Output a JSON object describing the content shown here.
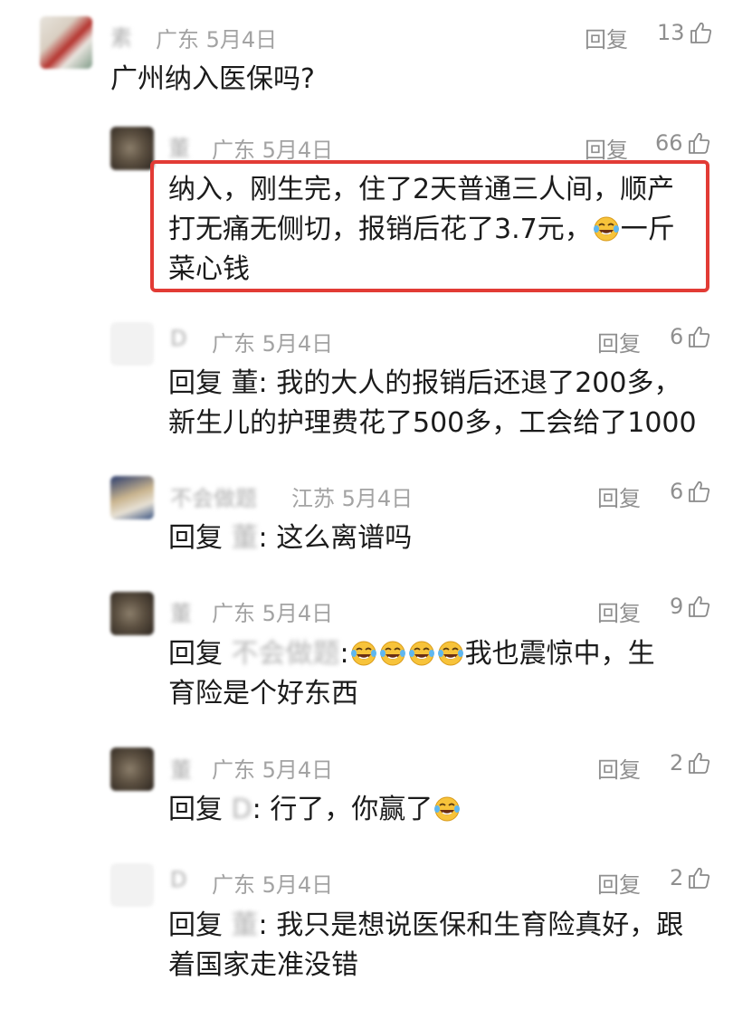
{
  "comments": [
    {
      "id": "c1",
      "user": "素",
      "location": "广东",
      "date": "5月4日",
      "reply_label": "回复",
      "likes": "13",
      "lines": [
        "广州纳入医保吗?"
      ]
    },
    {
      "id": "c2",
      "user": "董",
      "location": "广东",
      "date": "5月4日",
      "reply_label": "回复",
      "likes": "66",
      "lines": [
        "纳入，刚生完，住了2天普通三人间，顺产",
        "打无痛无侧切，报销后花了3.7元，",
        "一斤",
        "菜心钱"
      ]
    },
    {
      "id": "c3",
      "user": "D",
      "location": "广东",
      "date": "5月4日",
      "reply_label": "回复",
      "likes": "6",
      "reply_to": "董",
      "lines": [
        "回复",
        "我的大人的报销后还退了200多，",
        "新生儿的护理费花了500多，工会给了1000"
      ]
    },
    {
      "id": "c4",
      "user": "不会做题",
      "location": "江苏",
      "date": "5月4日",
      "reply_label": "回复",
      "likes": "6",
      "reply_to": "董",
      "lines": [
        "回复",
        "这么离谱吗"
      ]
    },
    {
      "id": "c5",
      "user": "董",
      "location": "广东",
      "date": "5月4日",
      "reply_label": "回复",
      "likes": "9",
      "reply_to": "不会做题",
      "lines": [
        "回复",
        "我也震惊中，生",
        "育险是个好东西"
      ]
    },
    {
      "id": "c6",
      "user": "董",
      "location": "广东",
      "date": "5月4日",
      "reply_label": "回复",
      "likes": "2",
      "reply_to": "D",
      "lines": [
        "回复",
        "行了，你赢了"
      ]
    },
    {
      "id": "c7",
      "user": "D",
      "location": "广东",
      "date": "5月4日",
      "reply_label": "回复",
      "likes": "2",
      "reply_to": "董",
      "lines": [
        "回复",
        "我只是想说医保和生育险真好，跟",
        "着国家走准没错"
      ]
    }
  ],
  "colors": {
    "highlight_border": "#e23b35",
    "meta_text": "#a3a3a3",
    "body_text": "#1b1b1b"
  },
  "icons": {
    "like": "thumbs-up-icon",
    "laugh": "laughing-tears-emoji"
  }
}
